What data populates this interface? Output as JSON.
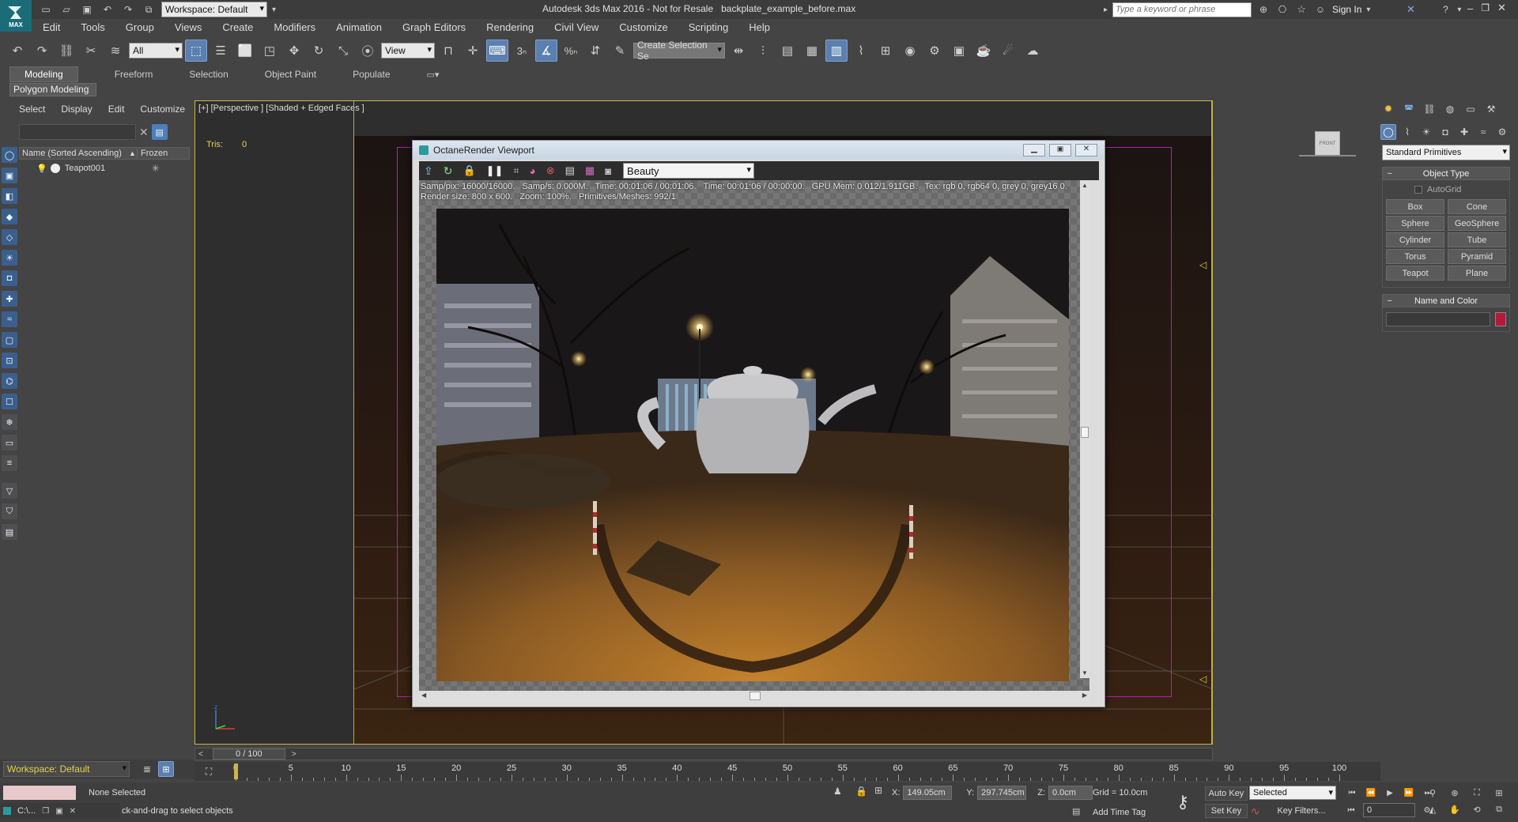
{
  "app": {
    "logo_text": "MAX",
    "title": "Autodesk 3ds Max 2016 - Not for Resale   backplate_example_before.max",
    "workspace_label": "Workspace: Default",
    "search_placeholder": "Type a keyword or phrase",
    "sign_in": "Sign In"
  },
  "menu": [
    "Edit",
    "Tools",
    "Group",
    "Views",
    "Create",
    "Modifiers",
    "Animation",
    "Graph Editors",
    "Rendering",
    "Civil View",
    "Customize",
    "Scripting",
    "Help"
  ],
  "toolbar": {
    "filter_value": "All",
    "view_value": "View",
    "selection_set_value": "Create Selection Se",
    "snap_number": "3",
    "percent_label": "%"
  },
  "ribbon": {
    "tabs": [
      "Modeling",
      "Freeform",
      "Selection",
      "Object Paint",
      "Populate"
    ],
    "sub_label": "Polygon Modeling"
  },
  "scene_explorer": {
    "tabs": [
      "Select",
      "Display",
      "Edit",
      "Customize"
    ],
    "col_name": "Name (Sorted Ascending)",
    "col_frozen": "Frozen",
    "items": [
      {
        "name": "Teapot001"
      }
    ]
  },
  "viewport": {
    "label": "[+] [Perspective ] [Shaded + Edged Faces ]",
    "stats_label": "Tris:",
    "stats_value": "0",
    "viewcube_label": "FRONT"
  },
  "octane": {
    "title": "OctaneRender Viewport",
    "pass_value": "Beauty",
    "stats_line1": "Samp/pix: 16000/16000.   Samp/s: 0.000M.   Time: 00:01:06 / 00:01:06.   Time: 00:01:06 / 00:00:00.   GPU Mem: 0.012/1.911GB.   Tex: rgb 0, rgb64 0, grey 0, grey16 0.",
    "stats_line2": "Render size: 800 x 600.   Zoom: 100%.   Primitives/Meshes: 992/1"
  },
  "command_panel": {
    "category_value": "Standard Primitives",
    "object_type_header": "Object Type",
    "autogrid_label": "AutoGrid",
    "buttons": [
      "Box",
      "Cone",
      "Sphere",
      "GeoSphere",
      "Cylinder",
      "Tube",
      "Torus",
      "Pyramid",
      "Teapot",
      "Plane"
    ],
    "name_color_header": "Name and Color",
    "object_color": "#b31a3a"
  },
  "timeline": {
    "frame_counter": "0 / 100",
    "ticks": [
      "0",
      "5",
      "10",
      "15",
      "20",
      "25",
      "30",
      "35",
      "40",
      "45",
      "50",
      "55",
      "60",
      "65",
      "70",
      "75",
      "80",
      "85",
      "90",
      "95",
      "100"
    ]
  },
  "status": {
    "workspace_label": "Workspace: Default",
    "selection_status": "None Selected",
    "prompt": "ck-and-drag to select objects",
    "taskbar_label": "C:\\...",
    "x_label": "X:",
    "x_value": "149.05cm",
    "y_label": "Y:",
    "y_value": "297.745cm",
    "z_label": "Z:",
    "z_value": "0.0cm",
    "grid": "Grid = 10.0cm",
    "add_time_tag": "Add Time Tag",
    "auto_key": "Auto Key",
    "set_key": "Set Key",
    "key_mode_value": "Selected",
    "key_filters": "Key Filters...",
    "current_frame": "0"
  }
}
